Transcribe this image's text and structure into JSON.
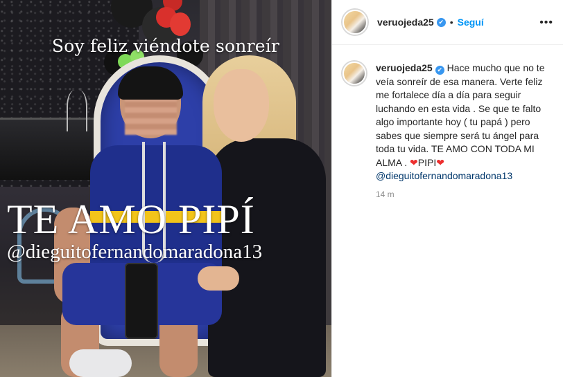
{
  "photo": {
    "caption_top": "Soy feliz viéndote sonreír",
    "caption_big": "TE AMO PIPÍ",
    "caption_handle": "@dieguitofernandomaradona13"
  },
  "header": {
    "username": "veruojeda25",
    "separator": "•",
    "follow_label": "Seguí",
    "more_icon": "more-horizontal-icon"
  },
  "comment": {
    "username": "veruojeda25",
    "text_1": "Hace mucho que no te veía sonreír de esa manera. Verte feliz me fortalece día a día para seguir luchando en esta vida . Se que te falto algo importante hoy ( tu papá ) pero sabes que siempre será tu ángel para toda tu vida. TE AMO CON TODA MI ALMA .",
    "heart": "❤",
    "text_2": "PIPI",
    "mention": "@dieguitofernandomaradona13",
    "time": "14 m"
  },
  "colors": {
    "accent": "#0095f6",
    "verified": "#3897f0",
    "heart": "#ed2f2f",
    "mention": "#00376b",
    "muted": "#8e8e8e"
  }
}
